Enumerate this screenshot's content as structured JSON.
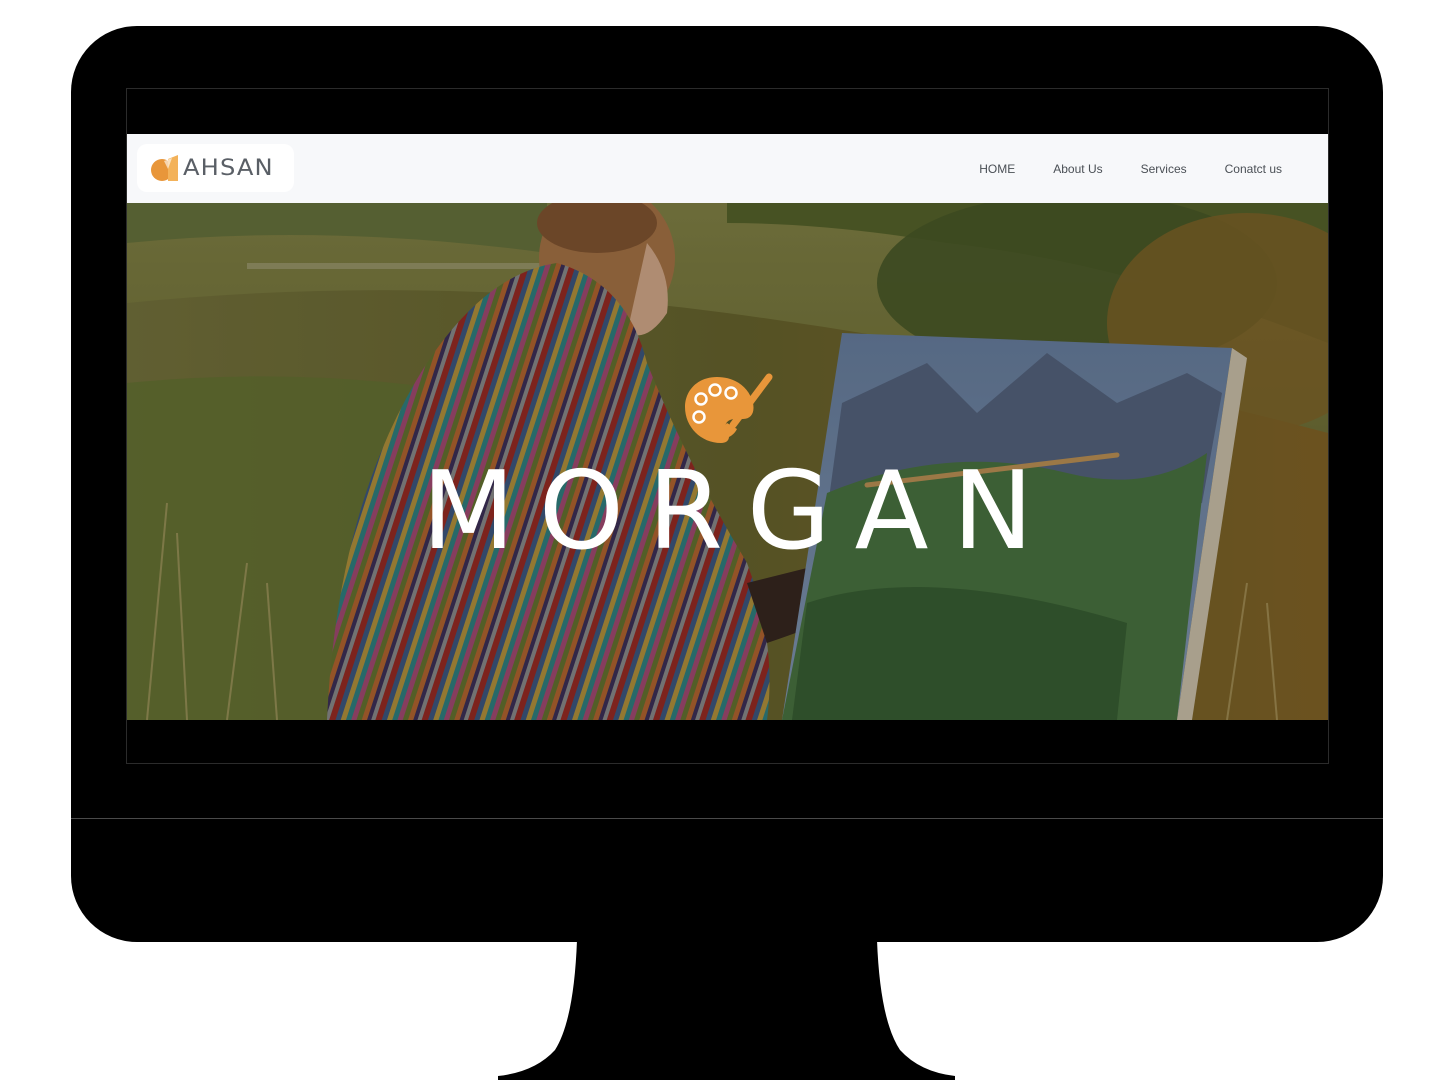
{
  "site": {
    "brand": {
      "name": "AHSAN",
      "icon": "brand-logo-icon"
    },
    "nav": {
      "items": [
        {
          "label": "HOME"
        },
        {
          "label": "About Us"
        },
        {
          "label": "Services"
        },
        {
          "label": "Conatct us"
        }
      ]
    },
    "hero": {
      "title": "MORGAN",
      "icon": "palette-brush-icon",
      "image": "woman painting mountain landscape on easel outdoors"
    }
  },
  "colors": {
    "accent": "#e8963a",
    "navbar_bg": "#f7f8fa",
    "frame": "#000000",
    "hero_text": "#ffffff"
  }
}
